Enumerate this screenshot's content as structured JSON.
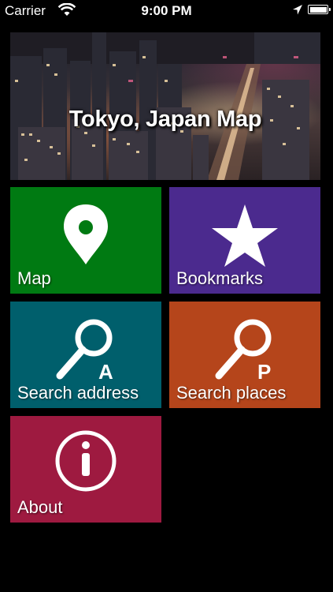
{
  "status_bar": {
    "carrier": "Carrier",
    "time": "9:00 PM"
  },
  "hero": {
    "title": "Tokyo, Japan Map"
  },
  "tiles": [
    {
      "label": "Map",
      "color": "#007a12",
      "icon": "map-pin-icon"
    },
    {
      "label": "Bookmarks",
      "color": "#4b2a8e",
      "icon": "star-icon"
    },
    {
      "label": "Search address",
      "color": "#005f6c",
      "icon": "magnifier-a-icon",
      "icon_letter": "A"
    },
    {
      "label": "Search places",
      "color": "#b5451b",
      "icon": "magnifier-p-icon",
      "icon_letter": "P"
    },
    {
      "label": "About",
      "color": "#9e1a40",
      "icon": "info-icon"
    }
  ]
}
